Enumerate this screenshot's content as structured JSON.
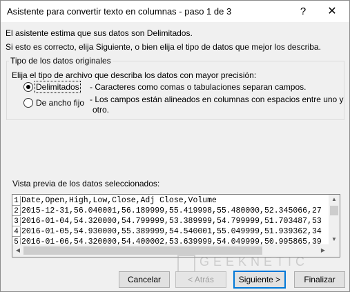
{
  "window": {
    "title": "Asistente para convertir texto en columnas - paso 1 de 3",
    "help_glyph": "?",
    "close_glyph": "✕"
  },
  "intro": {
    "line1": "El asistente estima que sus datos son Delimitados.",
    "line2": "Si esto es correcto, elija Siguiente, o bien elija el tipo de datos que mejor los describa."
  },
  "original_data": {
    "group_label": "Tipo de los datos originales",
    "prompt": "Elija el tipo de archivo que describa los datos con mayor precisión:",
    "options": [
      {
        "label": "Delimitados",
        "description": "- Caracteres como comas o tabulaciones separan campos.",
        "selected": true
      },
      {
        "label": "De ancho fijo",
        "description_line1": "- Los campos están alineados en columnas con espacios entre uno y",
        "description_line2": "otro.",
        "selected": false
      }
    ]
  },
  "preview": {
    "label": "Vista previa de los datos seleccionados:",
    "rows": [
      {
        "num": "1",
        "text": "Date,Open,High,Low,Close,Adj Close,Volume"
      },
      {
        "num": "2",
        "text": "2015-12-31,56.040001,56.189999,55.419998,55.480000,52.345066,27"
      },
      {
        "num": "3",
        "text": "2016-01-04,54.320000,54.799999,53.389999,54.799999,51.703487,53"
      },
      {
        "num": "4",
        "text": "2016-01-05,54.930000,55.389999,54.540001,55.049999,51.939362,34"
      },
      {
        "num": "5",
        "text": "2016-01-06,54.320000,54.400002,53.639999,54.049999,50.995865,39"
      }
    ]
  },
  "buttons": {
    "cancel": "Cancelar",
    "back": "< Atrás",
    "next": "Siguiente >",
    "finish": "Finalizar"
  },
  "watermark": {
    "text": "GEEKNETIC"
  }
}
